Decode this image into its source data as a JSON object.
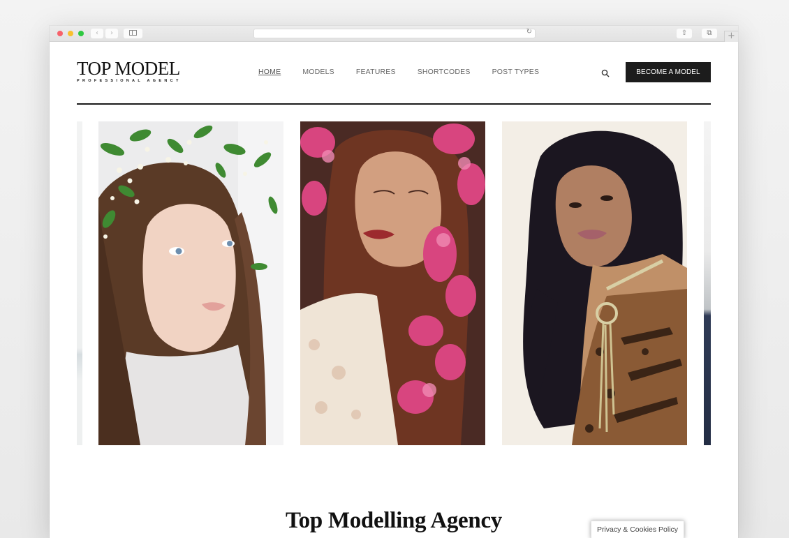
{
  "browser": {
    "back_icon": "‹",
    "forward_icon": "›",
    "reload_icon": "↻",
    "share_icon": "⇧",
    "tabs_icon": "⧉",
    "new_tab_icon": "+"
  },
  "header": {
    "logo_title": "TOP MODEL",
    "logo_subtitle": "PROFESSIONAL AGENCY",
    "nav": [
      {
        "label": "HOME",
        "active": true
      },
      {
        "label": "MODELS",
        "active": false
      },
      {
        "label": "FEATURES",
        "active": false
      },
      {
        "label": "SHORTCODES",
        "active": false
      },
      {
        "label": "POST TYPES",
        "active": false
      }
    ],
    "cta_label": "BECOME A MODEL"
  },
  "carousel": {
    "slides": [
      {
        "description": "Model with green floral crown, light background"
      },
      {
        "description": "Model with eyes closed among pink blossoms, lace top"
      },
      {
        "description": "Model with long dark wavy hair, leopard print top and gold necklace"
      }
    ]
  },
  "main": {
    "section_title": "Top Modelling Agency"
  },
  "cookie": {
    "label": "Privacy & Cookies Policy"
  },
  "colors": {
    "button_bg": "#1c1c1c",
    "text_dark": "#111111",
    "nav_text": "#666666"
  }
}
